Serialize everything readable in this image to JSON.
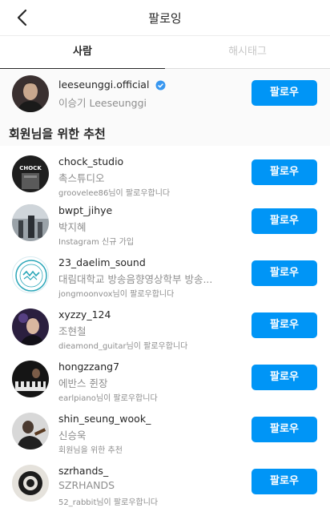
{
  "header": {
    "title": "팔로잉",
    "back_icon": "chevron-left-icon"
  },
  "tabs": [
    {
      "label": "사람",
      "active": true
    },
    {
      "label": "해시태그",
      "active": false
    }
  ],
  "following": {
    "username": "leeseunggi.official",
    "full_name": "이승기 Leeseunggi",
    "verified": true,
    "button": "팔로우"
  },
  "suggestions": {
    "title": "회원님을 위한 추천",
    "items": [
      {
        "username": "chock_studio",
        "full_name": "촉스튜디오",
        "note": "groovelee86님이 팔로우합니다",
        "button": "팔로우",
        "avatar_text": "CHOCK"
      },
      {
        "username": "bwpt_jihye",
        "full_name": "박지혜",
        "note": "Instagram 신규 가입",
        "button": "팔로우"
      },
      {
        "username": "23_daelim_sound",
        "full_name": "대림대학교 방송음향영상학부 방송...",
        "note": "jongmoonvox님이 팔로우합니다",
        "button": "팔로우"
      },
      {
        "username": "xyzzy_124",
        "full_name": "조현철",
        "note": "dieamond_guitar님이 팔로우합니다",
        "button": "팔로우"
      },
      {
        "username": "hongzzang7",
        "full_name": "에반스 쥔장",
        "note": "earlpiano님이 팔로우합니다",
        "button": "팔로우"
      },
      {
        "username": "shin_seung_wook_",
        "full_name": "신승욱",
        "note": "회원님을 위한 추천",
        "button": "팔로우"
      },
      {
        "username": "szrhands_",
        "full_name": "SZRHANDS",
        "note": "52_rabbit님이 팔로우합니다",
        "button": "팔로우"
      }
    ]
  },
  "colors": {
    "accent": "#0095f6",
    "verified": "#3897f0",
    "secondary_text": "#8e8e8e"
  }
}
